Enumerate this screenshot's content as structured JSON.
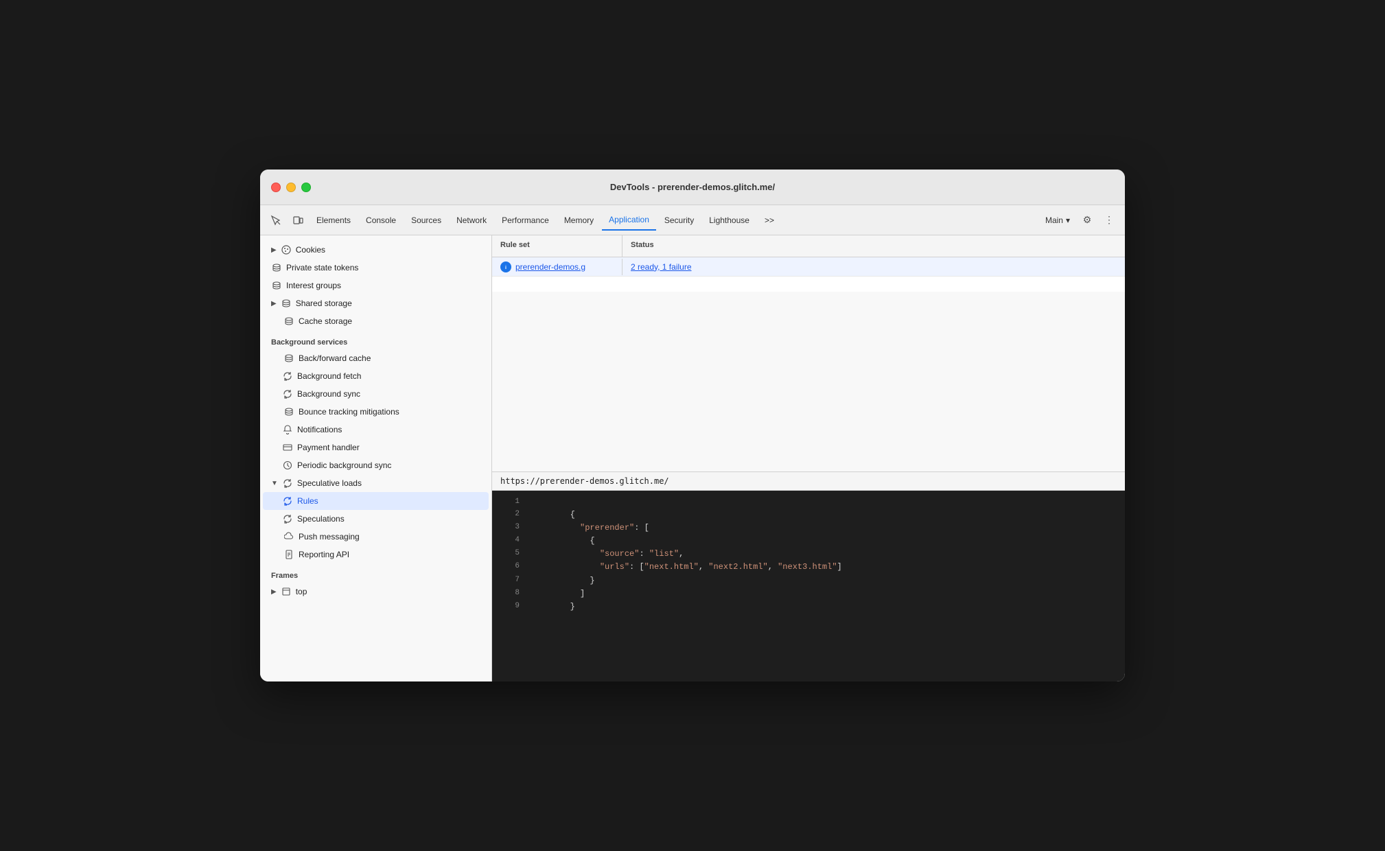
{
  "window": {
    "title": "DevTools - prerender-demos.glitch.me/"
  },
  "toolbar": {
    "tabs": [
      {
        "label": "Elements",
        "active": false
      },
      {
        "label": "Console",
        "active": false
      },
      {
        "label": "Sources",
        "active": false
      },
      {
        "label": "Network",
        "active": false
      },
      {
        "label": "Performance",
        "active": false
      },
      {
        "label": "Memory",
        "active": false
      },
      {
        "label": "Application",
        "active": true
      },
      {
        "label": "Security",
        "active": false
      },
      {
        "label": "Lighthouse",
        "active": false
      }
    ],
    "more_label": ">>",
    "main_label": "Main",
    "settings_icon": "⚙",
    "more_icon": "⋮"
  },
  "sidebar": {
    "sections": [
      {
        "label": "",
        "items": [
          {
            "id": "cookies",
            "label": "Cookies",
            "icon": "cookie",
            "indent": 0,
            "expandable": true
          },
          {
            "id": "private-state-tokens",
            "label": "Private state tokens",
            "icon": "db",
            "indent": 0
          },
          {
            "id": "interest-groups",
            "label": "Interest groups",
            "icon": "db",
            "indent": 0
          },
          {
            "id": "shared-storage",
            "label": "Shared storage",
            "icon": "db",
            "indent": 0,
            "expandable": true
          },
          {
            "id": "cache-storage",
            "label": "Cache storage",
            "icon": "db",
            "indent": 0
          }
        ]
      },
      {
        "label": "Background services",
        "items": [
          {
            "id": "back-forward-cache",
            "label": "Back/forward cache",
            "icon": "db",
            "indent": 0
          },
          {
            "id": "background-fetch",
            "label": "Background fetch",
            "icon": "sync",
            "indent": 0
          },
          {
            "id": "background-sync",
            "label": "Background sync",
            "icon": "sync",
            "indent": 0
          },
          {
            "id": "bounce-tracking",
            "label": "Bounce tracking mitigations",
            "icon": "db",
            "indent": 0
          },
          {
            "id": "notifications",
            "label": "Notifications",
            "icon": "bell",
            "indent": 0
          },
          {
            "id": "payment-handler",
            "label": "Payment handler",
            "icon": "card",
            "indent": 0
          },
          {
            "id": "periodic-background-sync",
            "label": "Periodic background sync",
            "icon": "clock",
            "indent": 0
          },
          {
            "id": "speculative-loads",
            "label": "Speculative loads",
            "icon": "sync",
            "indent": 0,
            "expandable": true,
            "expanded": true
          },
          {
            "id": "rules",
            "label": "Rules",
            "icon": "sync",
            "indent": 1,
            "active": true
          },
          {
            "id": "speculations",
            "label": "Speculations",
            "icon": "sync",
            "indent": 1
          },
          {
            "id": "push-messaging",
            "label": "Push messaging",
            "icon": "cloud",
            "indent": 0
          },
          {
            "id": "reporting-api",
            "label": "Reporting API",
            "icon": "doc",
            "indent": 0
          }
        ]
      },
      {
        "label": "Frames",
        "items": [
          {
            "id": "top",
            "label": "top",
            "icon": "frame",
            "indent": 0,
            "expandable": true
          }
        ]
      }
    ]
  },
  "table": {
    "headers": [
      "Rule set",
      "Status"
    ],
    "rows": [
      {
        "rule_set": "prerender-demos.g",
        "status": "2 ready, 1 failure",
        "has_icon": true
      }
    ]
  },
  "detail": {
    "url": "https://prerender-demos.glitch.me/",
    "code_lines": [
      {
        "num": "1",
        "content": ""
      },
      {
        "num": "2",
        "content": "        {"
      },
      {
        "num": "3",
        "content": "          \"prerender\": [",
        "string_parts": [
          {
            "text": "\"prerender\"",
            "is_string": true
          },
          {
            "text": ": [",
            "is_string": false
          }
        ]
      },
      {
        "num": "4",
        "content": "            {"
      },
      {
        "num": "5",
        "content": "              \"source\": \"list\",",
        "string_parts": [
          {
            "text": "\"source\"",
            "is_string": true
          },
          {
            "text": ": ",
            "is_string": false
          },
          {
            "text": "\"list\"",
            "is_string": true
          },
          {
            "text": ",",
            "is_string": false
          }
        ]
      },
      {
        "num": "6",
        "content": "              \"urls\": [\"next.html\", \"next2.html\", \"next3.html\"]",
        "string_parts": [
          {
            "text": "\"urls\"",
            "is_string": true
          },
          {
            "text": ": [",
            "is_string": false
          },
          {
            "text": "\"next.html\"",
            "is_string": true
          },
          {
            "text": ", ",
            "is_string": false
          },
          {
            "text": "\"next2.html\"",
            "is_string": true
          },
          {
            "text": ", ",
            "is_string": false
          },
          {
            "text": "\"next3.html\"",
            "is_string": true
          },
          {
            "text": "]",
            "is_string": false
          }
        ]
      },
      {
        "num": "7",
        "content": "            }"
      },
      {
        "num": "8",
        "content": "          ]"
      },
      {
        "num": "9",
        "content": "        }"
      }
    ]
  }
}
